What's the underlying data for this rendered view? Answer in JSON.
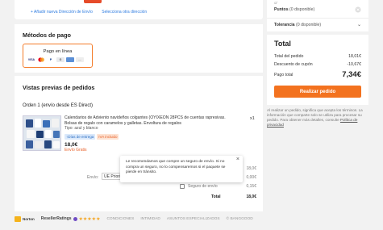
{
  "address": {
    "add_link": "+ Añadir nueva Dirección de Envío",
    "select_link": "Selecciona otra dirección"
  },
  "payment": {
    "title": "Métodos de pago",
    "online_label": "Pago en línea",
    "icons": [
      "VISA",
      "MC",
      "PayPal",
      "GPay",
      "ApplePay",
      "other"
    ]
  },
  "orders": {
    "title": "Vistas previas de pedidos",
    "order_header": "Orden 1 (envío desde ES Direct)",
    "product": {
      "title": "Calendarios de Adviento navideños colgantes (OYIXEON 28PCS de cuentas rapresivas. Bolsas de regalo con caramelos y galletas. Envoltura de regalos",
      "meta": "Tipo: azul y blanco",
      "badges": [
        "↑Días de entrega",
        "IVA incluido"
      ],
      "price": "18,0€",
      "shipping": "Envío Gratis",
      "qty": "x1"
    },
    "sub_rows": [
      "18,0€",
      "0,00€",
      "0,15€"
    ],
    "envio_label": "Envío:",
    "envio_select": "UE Priorit...",
    "insurance_label": "Seguro de envío",
    "total_label": "Total",
    "total_value": "18,0€"
  },
  "tooltip": {
    "text": "Le recomendamos que compre un seguro de envío. Si no compra un seguro, no lo compensaremos si el paquete se pierde en tránsito.",
    "close": "×"
  },
  "summary": {
    "top_small": "o/",
    "puntos_label": "Puntos",
    "puntos_detail": "(0 disponible)",
    "tolerancia_label": "Tolerancia",
    "tolerancia_detail": "(0 disponible)",
    "title": "Total",
    "rows": [
      {
        "label": "Total del pedido",
        "value": "18,01€"
      },
      {
        "label": "Descuento de cupón",
        "value": "-10,67€"
      }
    ],
    "pago_total_label": "Pago total",
    "pago_total_value": "7,34€",
    "button": "Realizar pedido",
    "legal_text": "Al realizar un pedido, significa que acepta los términos. La información que comparte solo se utiliza para procesar su pedido. Para obtener más detalles, consulte",
    "legal_link": "Política de privacidad"
  },
  "footer": {
    "brand": "Norton",
    "reseller": "ResellerRatings",
    "stars": "★★★★★",
    "links": [
      "CONDICIONES",
      "INTIMIDAD",
      "ASUNTOS ESPECIALIZADOS",
      "© BANGGOOD"
    ]
  },
  "colors": {
    "accent": "#f3721f",
    "link": "#2d7be0",
    "background": "#f2f2f2"
  }
}
